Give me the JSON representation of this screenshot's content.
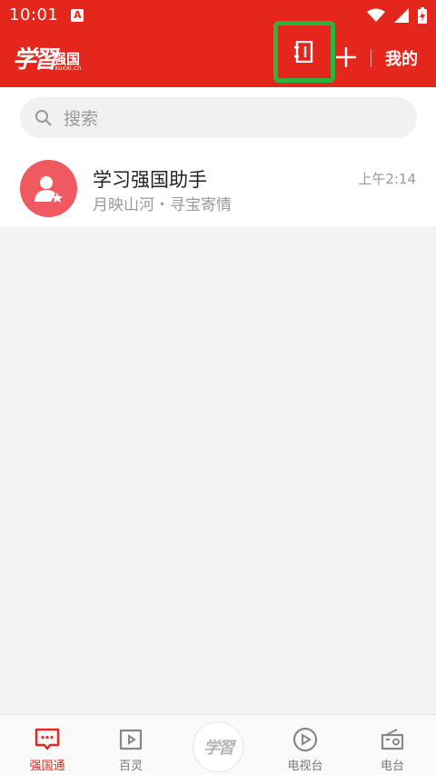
{
  "status_bar": {
    "time": "10:01",
    "notif_glyph": "A"
  },
  "header": {
    "logo_script": "学習",
    "logo_cn": "强国",
    "logo_domain": "xuexi.cn",
    "mine_label": "我的",
    "icons": [
      "contacts-icon",
      "plus-icon"
    ]
  },
  "search": {
    "placeholder": "搜索"
  },
  "chats": [
    {
      "name": "学习强国助手",
      "preview": "月映山河・寻宝寄情",
      "time": "上午2:14"
    }
  ],
  "bottom_nav": {
    "items": [
      {
        "label": "强国通",
        "icon": "chat-icon",
        "active": true
      },
      {
        "label": "百灵",
        "icon": "play-tab-icon",
        "active": false
      },
      {
        "label": "学習",
        "icon": "study-icon",
        "active": false
      },
      {
        "label": "电视台",
        "icon": "play-circle-icon",
        "active": false
      },
      {
        "label": "电台",
        "icon": "radio-icon",
        "active": false
      }
    ]
  },
  "colors": {
    "brand_red": "#e4261c",
    "highlight_green": "#2bb441",
    "avatar_red": "#ee5a5f"
  }
}
